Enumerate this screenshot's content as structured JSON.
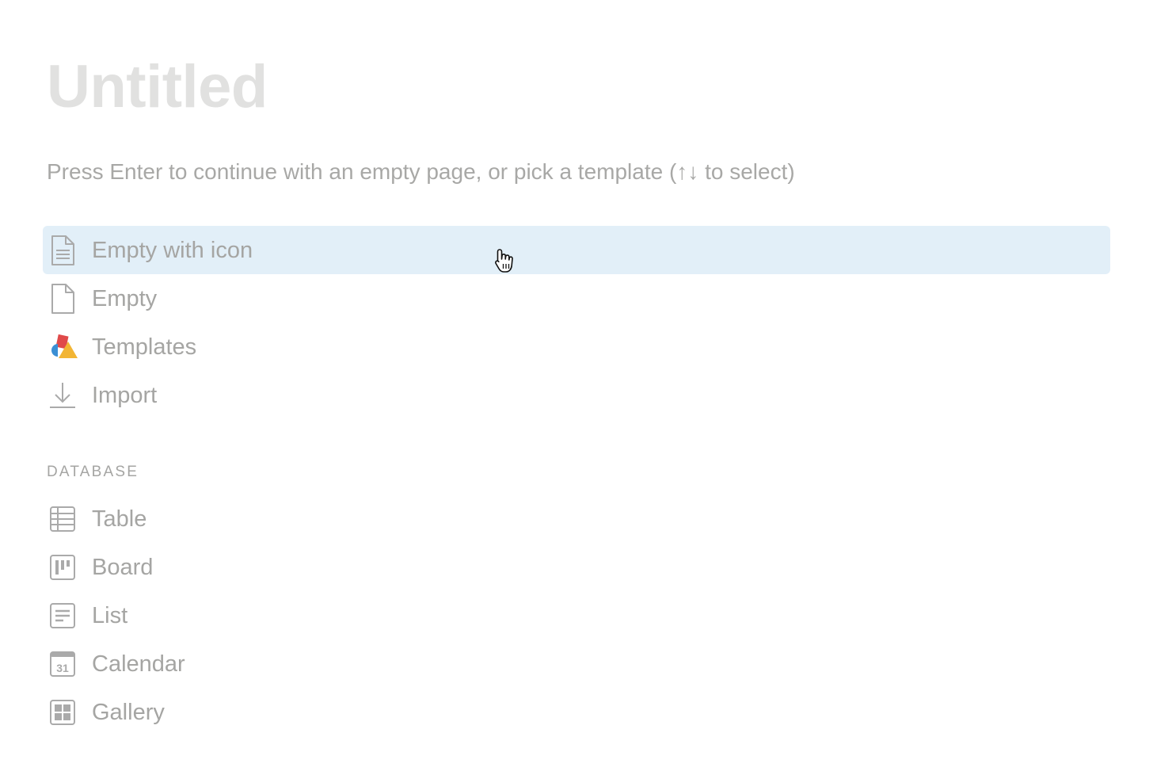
{
  "page": {
    "title": "Untitled",
    "hint": "Press Enter to continue with an empty page, or pick a template (↑↓ to select)"
  },
  "menu": {
    "items": [
      {
        "label": "Empty with icon",
        "icon": "document-lines-icon",
        "selected": true
      },
      {
        "label": "Empty",
        "icon": "document-icon"
      },
      {
        "label": "Templates",
        "icon": "templates-shapes-icon"
      },
      {
        "label": "Import",
        "icon": "download-icon"
      }
    ]
  },
  "database": {
    "header": "DATABASE",
    "items": [
      {
        "label": "Table",
        "icon": "table-icon"
      },
      {
        "label": "Board",
        "icon": "board-icon"
      },
      {
        "label": "List",
        "icon": "list-icon"
      },
      {
        "label": "Calendar",
        "icon": "calendar-icon",
        "icon_text": "31"
      },
      {
        "label": "Gallery",
        "icon": "gallery-icon"
      }
    ]
  },
  "colors": {
    "title": "#e1e1e0",
    "text": "#a5a5a3",
    "selected_bg": "#e2eff8",
    "icon": "#aaaaaa",
    "templates_red": "#e04a4a",
    "templates_blue": "#3b8fd4",
    "templates_yellow": "#f2b534"
  }
}
